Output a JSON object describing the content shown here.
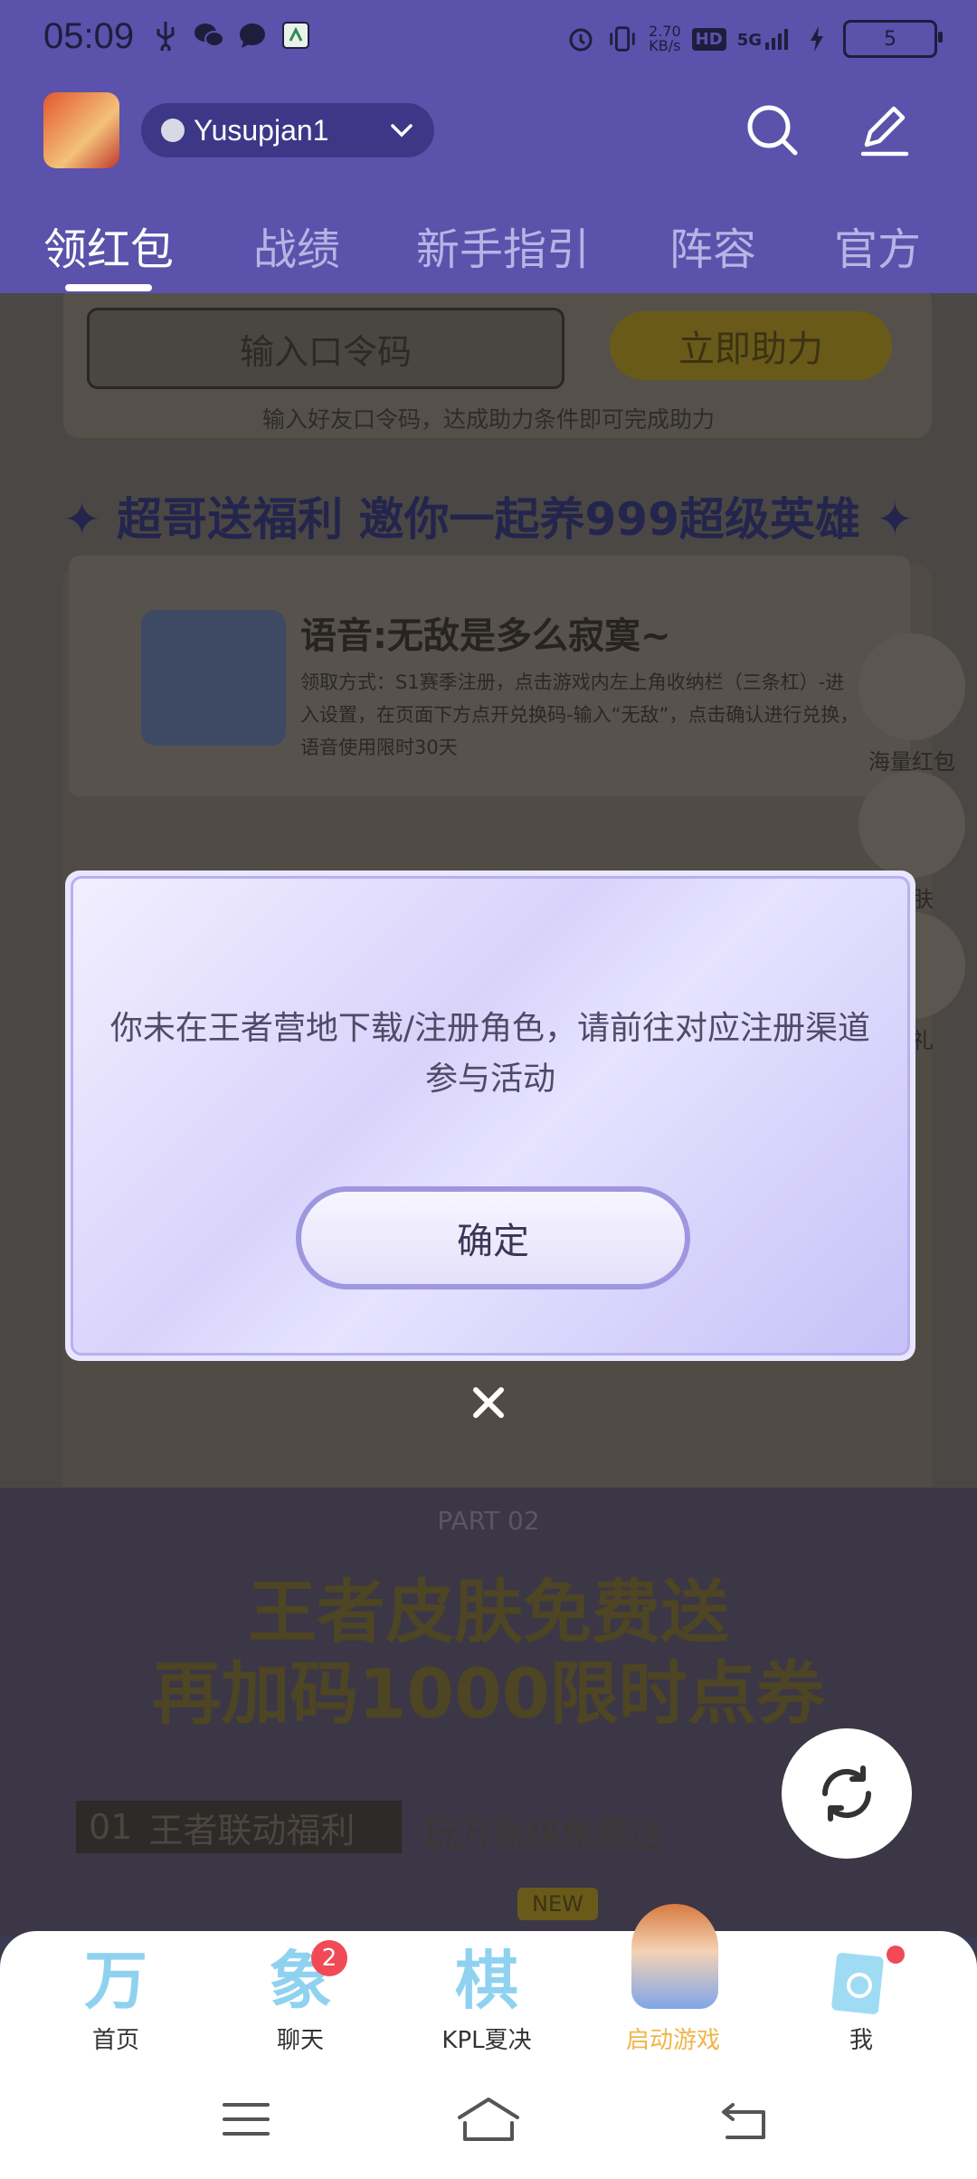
{
  "status_bar": {
    "time": "05:09",
    "net_speed_value": "2.70",
    "net_speed_unit": "KB/s",
    "hd_label": "HD",
    "network": "5G",
    "battery": "5"
  },
  "header": {
    "account_name": "Yusupjan1"
  },
  "tabs": [
    {
      "label": "领红包",
      "active": true
    },
    {
      "label": "战绩"
    },
    {
      "label": "新手指引"
    },
    {
      "label": "阵容"
    },
    {
      "label": "官方"
    }
  ],
  "background": {
    "code_input_placeholder": "输入口令码",
    "assist_button": "立即助力",
    "assist_hint": "输入好友口令码，达成助力条件即可完成助力",
    "banner_title": "✦ 超哥送福利 邀你一起养999超级英雄 ✦",
    "voice_title": "语音:无敌是多么寂寞~",
    "voice_desc": "领取方式：S1赛季注册，点击游戏内左上角收纳栏（三条杠）-进入设置，在页面下方点开兑换码-输入“无敌”，点击确认进行兑换，语音使用限时30天",
    "side_items": [
      "海量红包",
      "皮肤",
      "好礼"
    ],
    "part_label": "PART 02",
    "promo_line1": "王者皮肤免费送",
    "promo_line2": "再加码1000限时点券",
    "row_label_num": "01",
    "row_label_text": "王者联动福利",
    "row_label_extra": "玩万象棋免费送",
    "new_tag": "NEW"
  },
  "dialog": {
    "message": "你未在王者营地下载/注册角色，请前往对应注册渠道参与活动",
    "confirm_button": "确定"
  },
  "bottom_nav": [
    {
      "glyph": "万",
      "label": "首页"
    },
    {
      "glyph": "象",
      "label": "聊天",
      "badge": "2"
    },
    {
      "glyph": "棋",
      "label": "KPL夏决"
    },
    {
      "glyph": "",
      "label": "启动游戏"
    },
    {
      "glyph": "",
      "label": "我"
    }
  ],
  "colors": {
    "primary": "#5a52ab",
    "accent_gold": "#f0b54a",
    "badge_red": "#f04a57"
  }
}
